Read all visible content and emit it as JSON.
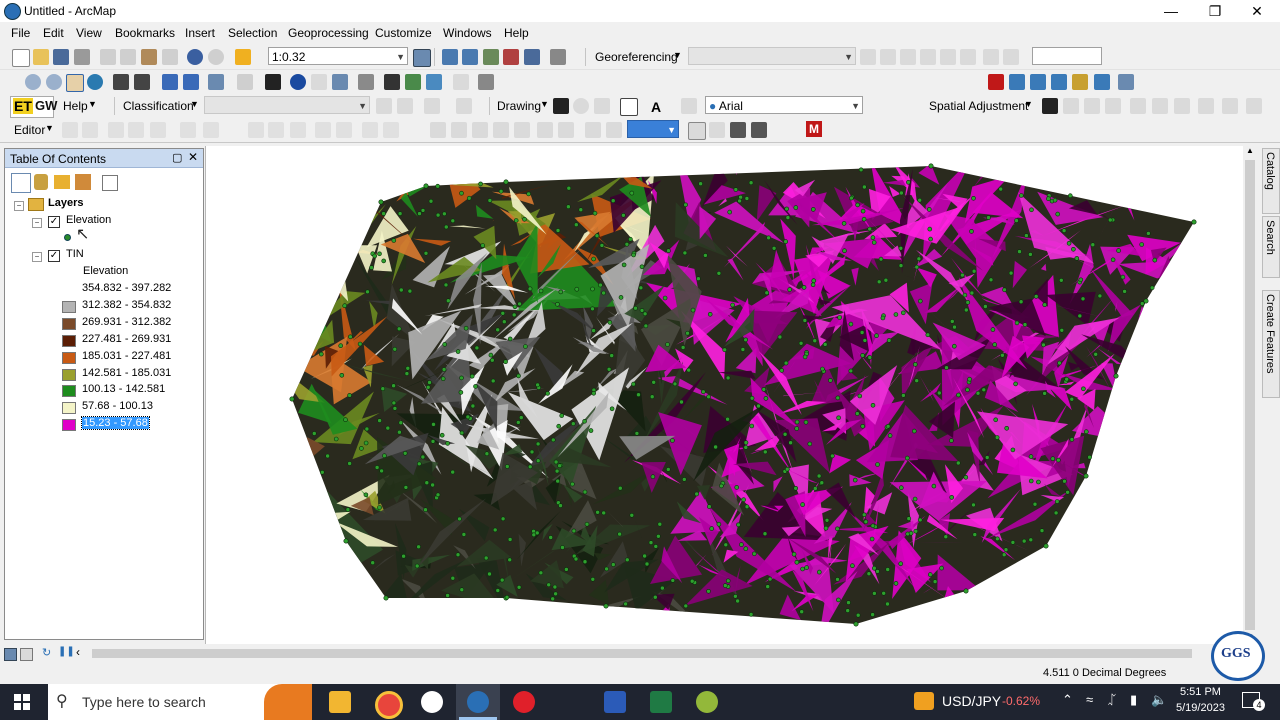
{
  "window": {
    "title": "Untitled - ArcMap"
  },
  "menu": [
    "File",
    "Edit",
    "View",
    "Bookmarks",
    "Insert",
    "Selection",
    "Geoprocessing",
    "Customize",
    "Windows",
    "Help"
  ],
  "toolbar1": {
    "scale": "1:0.32",
    "georeferencing": "Georeferencing"
  },
  "toolbar2": {},
  "toolbar3": {
    "etgw": "ET",
    "etgw_sub": "GW",
    "help": "Help",
    "classification": "Classification",
    "drawing": "Drawing",
    "font": "Arial",
    "spatial_adjustment": "Spatial Adjustment"
  },
  "toolbar4": {
    "editor": "Editor",
    "m_label": "M"
  },
  "toc": {
    "title": "Table Of Contents",
    "root": "Layers",
    "layers": [
      {
        "name": "Elevation",
        "checked": true
      },
      {
        "name": "TIN",
        "checked": true,
        "legend_title": "Elevation"
      }
    ],
    "classes": [
      {
        "label": "354.832 - 397.282",
        "color": "#ffffff"
      },
      {
        "label": "312.382 - 354.832",
        "color": "#b4b4b4"
      },
      {
        "label": "269.931 - 312.382",
        "color": "#7a4a2a"
      },
      {
        "label": "227.481 - 269.931",
        "color": "#5b1e05"
      },
      {
        "label": "185.031 - 227.481",
        "color": "#c85a14"
      },
      {
        "label": "142.581 - 185.031",
        "color": "#9aa02e"
      },
      {
        "label": "100.13 - 142.581",
        "color": "#1e8c1e"
      },
      {
        "label": "57.68 - 100.13",
        "color": "#f4f4c8"
      },
      {
        "label": "15.23 - 57.68",
        "color": "#e000c8",
        "selected": true
      }
    ]
  },
  "side_tabs": [
    "Catalog",
    "Search",
    "Create Features"
  ],
  "status": {
    "coords": "4.511  0 Decimal Degrees"
  },
  "logo": "GGS",
  "taskbar": {
    "search_placeholder": "Type here to search",
    "ticker_symbol": "USD/JPY",
    "ticker_change": "-0.62%",
    "time": "5:51 PM",
    "date": "5/19/2023",
    "notifications": "4"
  }
}
